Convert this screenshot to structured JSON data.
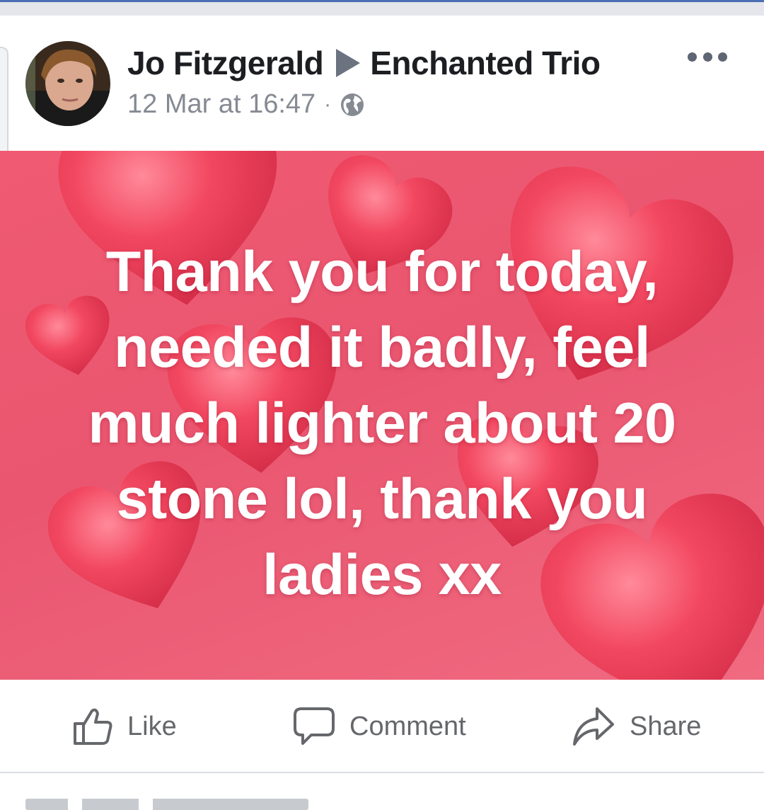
{
  "post": {
    "author": "Jo Fitzgerald",
    "group": "Enchanted Trio",
    "timestamp": "12 Mar at 16:47",
    "separator": "·",
    "privacy_icon": "globe-icon",
    "more_icon": "more-options-icon",
    "message_lines": [
      "Thank you for today,",
      "needed it badly, feel",
      "much lighter about 20",
      "stone lol, thank you",
      "ladies xx"
    ],
    "background_color": "#ec5870",
    "heart_color": "#f0455e"
  },
  "actions": {
    "like_label": "Like",
    "comment_label": "Comment",
    "share_label": "Share"
  },
  "colors": {
    "author_text": "#1c1e21",
    "meta_text": "#858a93",
    "action_text": "#65676b"
  }
}
